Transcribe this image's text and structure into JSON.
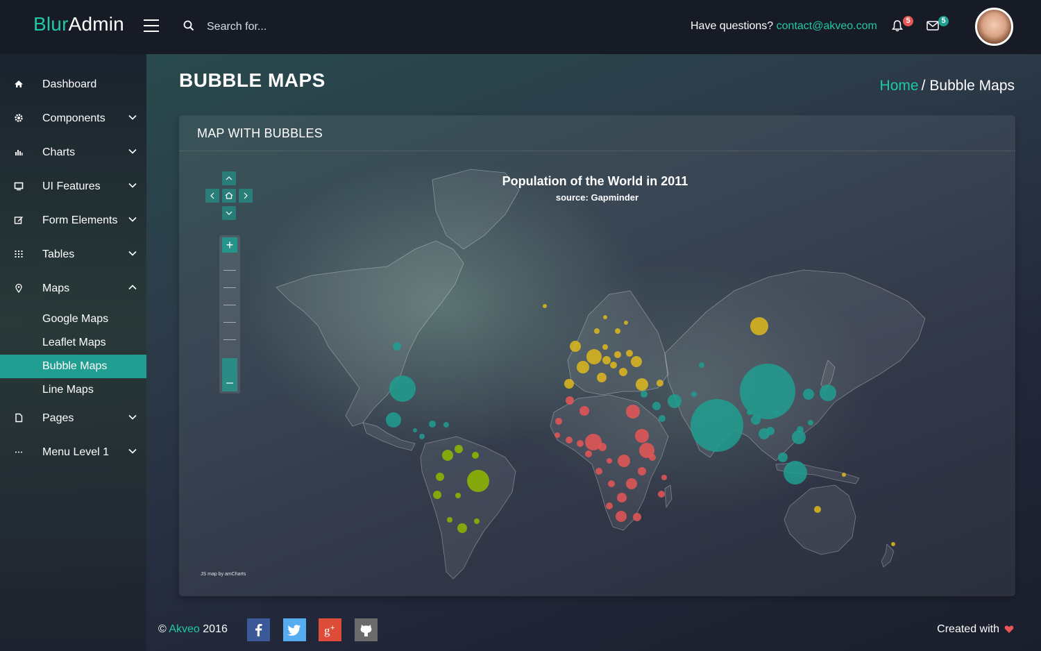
{
  "brand": {
    "part1": "Blur",
    "part2": "Admin"
  },
  "search": {
    "placeholder": "Search for..."
  },
  "header": {
    "questions": "Have questions?",
    "email": "contact@akveo.com",
    "notifications_count": "5",
    "messages_count": "5"
  },
  "sidebar": {
    "items": [
      {
        "label": "Dashboard",
        "icon": "home-icon"
      },
      {
        "label": "Components",
        "icon": "gear-icon"
      },
      {
        "label": "Charts",
        "icon": "bar-chart-icon"
      },
      {
        "label": "UI Features",
        "icon": "monitor-icon"
      },
      {
        "label": "Form Elements",
        "icon": "edit-icon"
      },
      {
        "label": "Tables",
        "icon": "grid-icon"
      },
      {
        "label": "Maps",
        "icon": "map-pin-icon"
      },
      {
        "label": "Pages",
        "icon": "file-icon"
      },
      {
        "label": "Menu Level 1",
        "icon": "more-icon"
      }
    ],
    "maps_sub": [
      {
        "label": "Google Maps"
      },
      {
        "label": "Leaflet Maps"
      },
      {
        "label": "Bubble Maps",
        "active": true
      },
      {
        "label": "Line Maps"
      }
    ]
  },
  "page": {
    "title": "BUBBLE MAPS",
    "breadcrumb_home": "Home",
    "breadcrumb_sep": "/",
    "breadcrumb_current": "Bubble Maps"
  },
  "panel": {
    "title": "MAP WITH BUBBLES",
    "map_title": "Population of the World in 2011",
    "map_subtitle": "source: Gapminder",
    "credit": "JS map by amCharts"
  },
  "colors": {
    "accent": "#209e91",
    "asia": "#209e91",
    "europe": "#dfb81c",
    "africa": "#e85656",
    "south_america": "#90b900"
  },
  "footer": {
    "copyright_symbol": "©",
    "company": "Akveo",
    "year": "2016",
    "created_with": "Created with"
  },
  "social": [
    "facebook-icon",
    "twitter-icon",
    "google-plus-icon",
    "github-icon"
  ]
}
